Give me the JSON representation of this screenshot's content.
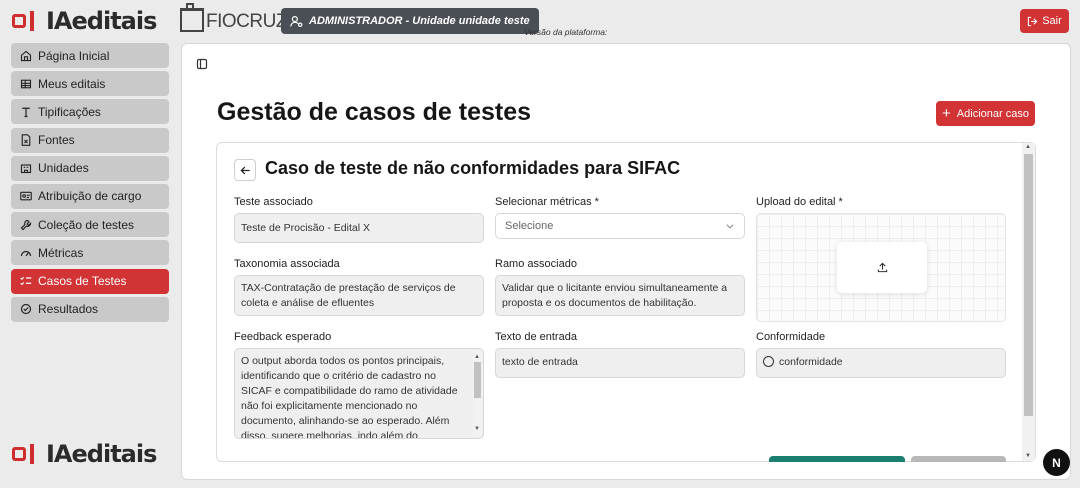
{
  "header": {
    "logo_text": "IAeditais",
    "partner_logo": "FIOCRUZ",
    "admin_badge": "ADMINISTRADOR - Unidade unidade teste",
    "version_label": "Versão da plataforma:",
    "logout_label": "Sair"
  },
  "sidebar": {
    "items": [
      {
        "label": "Página Inicial",
        "icon": "home-icon"
      },
      {
        "label": "Meus editais",
        "icon": "table-icon"
      },
      {
        "label": "Tipificações",
        "icon": "type-icon"
      },
      {
        "label": "Fontes",
        "icon": "file-icon"
      },
      {
        "label": "Unidades",
        "icon": "building-icon"
      },
      {
        "label": "Atribuição de cargo",
        "icon": "id-card-icon"
      },
      {
        "label": "Coleção de testes",
        "icon": "wrench-icon"
      },
      {
        "label": "Métricas",
        "icon": "gauge-icon"
      },
      {
        "label": "Casos de Testes",
        "icon": "list-check-icon",
        "active": true
      },
      {
        "label": "Resultados",
        "icon": "check-circle-icon"
      }
    ]
  },
  "main": {
    "title": "Gestão de casos de testes",
    "add_button": "Adicionar caso"
  },
  "form": {
    "title": "Caso de teste de não conformidades para SIFAC",
    "teste_associado": {
      "label": "Teste associado",
      "value": "Teste de Procisão - Edital X"
    },
    "metricas": {
      "label": "Selecionar métricas *",
      "placeholder": "Selecione"
    },
    "upload": {
      "label": "Upload do edital *"
    },
    "taxonomia": {
      "label": "Taxonomia associada",
      "value": "TAX-Contratação de prestação de serviços de coleta e análise de efluentes"
    },
    "ramo": {
      "label": "Ramo associado",
      "value": "Validar que o licitante enviou simultaneamente a proposta e os documentos de habilitação."
    },
    "feedback": {
      "label": "Feedback esperado",
      "value": "O output aborda todos os pontos principais, identificando que o critério de cadastro no SICAF e compatibilidade do ramo de atividade não foi explicitamente mencionado no documento, alinhando-se ao esperado. Além disso, sugere melhorias, indo além do esperado. No entanto, há"
    },
    "texto_entrada": {
      "label": "Texto de entrada",
      "value": "texto de entrada"
    },
    "conformidade": {
      "label": "Conformidade",
      "option": "conformidade"
    }
  },
  "floating_badge": "N",
  "colors": {
    "accent": "#d23335",
    "sidebar_item": "#c9c9c9",
    "primary_green": "#1a7f6e"
  }
}
